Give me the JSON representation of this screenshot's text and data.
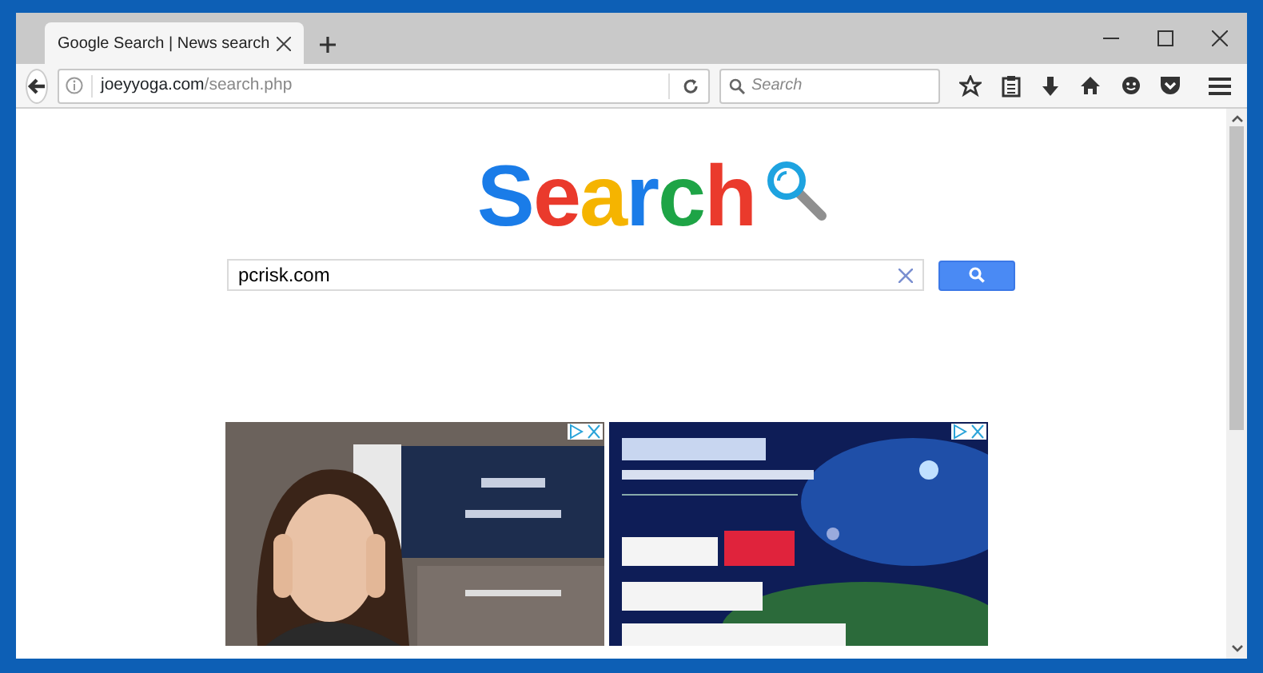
{
  "tabs": [
    {
      "title": "Google Search | News search",
      "selected": true
    }
  ],
  "address_bar": {
    "domain": "joeyyoga.com",
    "path": "/search.php"
  },
  "browser_search": {
    "placeholder": "Search"
  },
  "logo": {
    "text": "Search"
  },
  "search": {
    "value": "pcrisk.com"
  }
}
